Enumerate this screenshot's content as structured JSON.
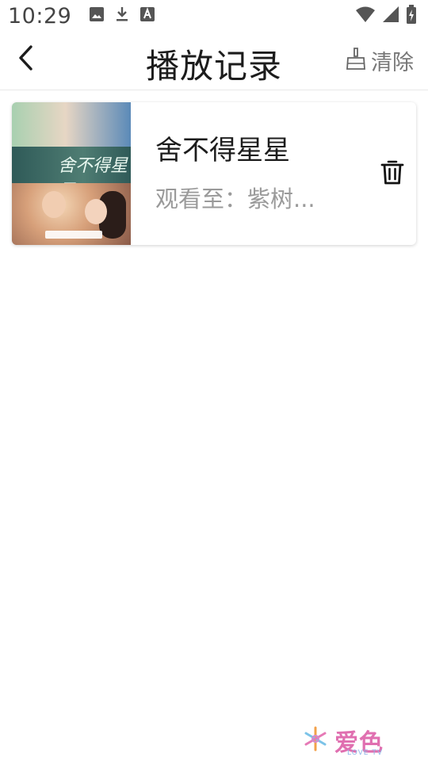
{
  "status_bar": {
    "time": "10:29",
    "left_icons": [
      "image-icon",
      "download-icon",
      "keyboard-a-icon"
    ],
    "right_icons": [
      "wifi-icon",
      "signal-icon",
      "battery-charging-icon"
    ]
  },
  "header": {
    "back_icon": "chevron-left-icon",
    "title": "播放记录",
    "clear_icon": "broom-icon",
    "clear_label": "清除"
  },
  "history": [
    {
      "title": "舍不得星星",
      "progress": "观看至：紫树...",
      "poster_title": "舍不得星星",
      "delete_icon": "trash-icon"
    }
  ],
  "watermark": {
    "logo_icon": "snowflake-logo-icon",
    "text": "爱色",
    "sub": "LOVE TV"
  },
  "colors": {
    "background": "#ffffff",
    "title_text": "#1c1c1c",
    "secondary_text": "#9a9a9a",
    "divider": "#e8e8e8",
    "watermark_pink": "#e06fb0"
  }
}
